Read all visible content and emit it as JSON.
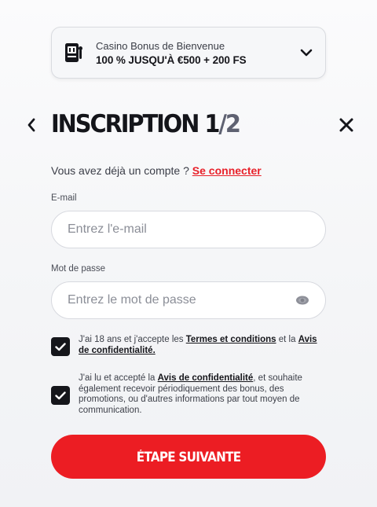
{
  "bonus": {
    "subtitle": "Casino Bonus de Bienvenue",
    "offer": "100 % JUSQU'À €500 + 200 FS",
    "icon": "slot-machine-icon"
  },
  "header": {
    "title": "INSCRIPTION",
    "step_current": "1",
    "step_total": "/2"
  },
  "login": {
    "prompt": "Vous avez déjà un compte ?",
    "link": "Se connecter"
  },
  "form": {
    "email_label": "E-mail",
    "email_placeholder": "Entrez l'e-mail",
    "password_label": "Mot de passe",
    "password_placeholder": "Entrez le mot de passe"
  },
  "consents": [
    {
      "checked": true,
      "text_before": "J'ai 18 ans et j'accepte les",
      "link1": "Termes et conditions",
      "text_mid": "et la",
      "link2": "Avis de confidentialité."
    },
    {
      "checked": true,
      "text_before": "J'ai lu et accepté la",
      "link1": "Avis de confidentialité",
      "text_after": ", et souhaite également recevoir périodiquement des bonus, des promotions, ou d'autres informations par tout moyen de communication."
    }
  ],
  "actions": {
    "next_label": "ÉTAPE SUIVANTE"
  },
  "colors": {
    "accent": "#ec1d23",
    "dark": "#15161b"
  }
}
